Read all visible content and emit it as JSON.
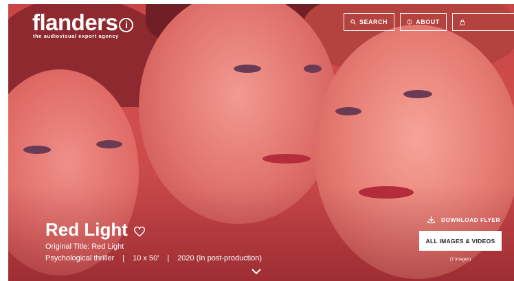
{
  "header": {
    "logo_word": "flanders",
    "logo_mark": "i",
    "logo_tagline": "the audiovisual export agency",
    "nav": {
      "search_label": "SEARCH",
      "about_label": "ABOUT"
    }
  },
  "production": {
    "title": "Red Light",
    "original_title": "Original Title: Red Light",
    "genre": "Psychological thriller",
    "episodes": "10 x 50'",
    "status": "2020 (In post-production)",
    "separator": "|"
  },
  "actions": {
    "download_label": "DOWNLOAD FLYER",
    "images_button_label": "ALL IMAGES & VIDEOS",
    "images_count": "(7 images)"
  },
  "icons": {
    "search": "search-icon",
    "about": "info-icon",
    "lock": "lock-icon",
    "favorite": "heart-icon",
    "download": "download-icon",
    "scroll": "chevron-down-icon"
  },
  "colors": {
    "hero_tint": "#d24e4e",
    "text": "#ffffff",
    "button_bg": "#ffffff",
    "button_text": "#222222"
  }
}
